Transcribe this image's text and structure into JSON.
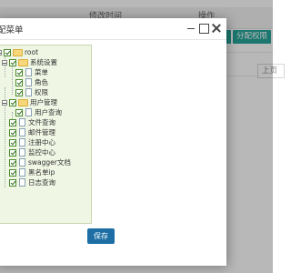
{
  "background": {
    "headers": [
      "修改时间",
      "操作"
    ],
    "assign_button": "分配权限",
    "prev_button": "上页"
  },
  "modal": {
    "title": "配菜单",
    "save_label": "保存"
  },
  "tree": {
    "root": "root",
    "system_settings": "系统设置",
    "system_children": [
      "菜单",
      "角色",
      "权限"
    ],
    "user_management": "用户管理",
    "user_children": [
      "用户查询"
    ],
    "root_items": [
      "文件查询",
      "邮件管理",
      "注册中心",
      "监控中心",
      "swagger文档",
      "黑名单ip",
      "日志查询"
    ]
  },
  "colors": {
    "tree_bg": "#f0f6e4",
    "save_bg": "#1c6ea4",
    "assign_bg": "#26a69a"
  }
}
